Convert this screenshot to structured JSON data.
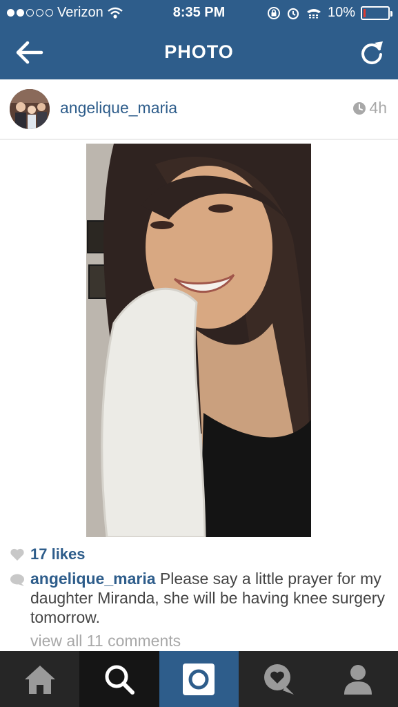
{
  "status_bar": {
    "carrier": "Verizon",
    "time": "8:35 PM",
    "battery": "10%",
    "battery_level": 0.1,
    "signal_bars_filled": 2,
    "signal_bars_total": 5
  },
  "nav": {
    "title": "PHOTO",
    "back_icon": "arrow-left-icon",
    "refresh_icon": "refresh-icon"
  },
  "post": {
    "username": "angelique_maria",
    "time_ago": "4h",
    "likes": "17 likes",
    "caption_user": "angelique_maria",
    "caption_text": " Please say a little prayer for my daughter Miranda, she will be having knee surgery tomorrow.",
    "view_comments": "view all 11 comments"
  },
  "tabbar": {
    "tabs": [
      "home-icon",
      "search-icon",
      "camera-icon",
      "activity-icon",
      "profile-icon"
    ]
  },
  "colors": {
    "brand": "#2e5d8b",
    "tabbar": "#262626",
    "muted": "#a8a8a8"
  }
}
